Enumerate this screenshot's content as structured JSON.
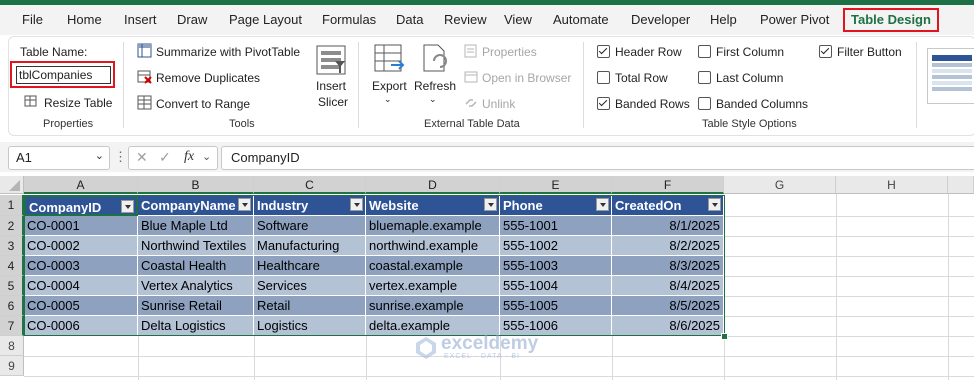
{
  "ribbon_tabs": [
    "File",
    "Home",
    "Insert",
    "Draw",
    "Page Layout",
    "Formulas",
    "Data",
    "Review",
    "View",
    "Automate",
    "Developer",
    "Help",
    "Power Pivot",
    "Table Design"
  ],
  "active_tab": "Table Design",
  "properties": {
    "table_name_label": "Table Name:",
    "table_name_value": "tblCompanies",
    "resize_table": "Resize Table",
    "group_label": "Properties"
  },
  "tools": {
    "summarize": "Summarize with PivotTable",
    "remove_duplicates": "Remove Duplicates",
    "convert_to_range": "Convert to Range",
    "insert_slicer_line1": "Insert",
    "insert_slicer_line2": "Slicer",
    "group_label": "Tools"
  },
  "external": {
    "export": "Export",
    "refresh": "Refresh",
    "properties": "Properties",
    "open_in_browser": "Open in Browser",
    "unlink": "Unlink",
    "group_label": "External Table Data"
  },
  "style_options": {
    "header_row": "Header Row",
    "total_row": "Total Row",
    "banded_rows": "Banded Rows",
    "first_column": "First Column",
    "last_column": "Last Column",
    "banded_columns": "Banded Columns",
    "filter_button": "Filter Button",
    "group_label": "Table Style Options",
    "checked": {
      "header_row": true,
      "total_row": false,
      "banded_rows": true,
      "first_column": false,
      "last_column": false,
      "banded_columns": false,
      "filter_button": true
    }
  },
  "formula_bar": {
    "name_box": "A1",
    "fx": "fx",
    "content": "CompanyID"
  },
  "columns": [
    "A",
    "B",
    "C",
    "D",
    "E",
    "F",
    "G",
    "H"
  ],
  "row_numbers": [
    "1",
    "2",
    "3",
    "4",
    "5",
    "6",
    "7",
    "8",
    "9"
  ],
  "table": {
    "headers": [
      "CompanyID",
      "CompanyName",
      "Industry",
      "Website",
      "Phone",
      "CreatedOn"
    ],
    "rows": [
      [
        "CO-0001",
        "Blue Maple Ltd",
        "Software",
        "bluemaple.example",
        "555-1001",
        "8/1/2025"
      ],
      [
        "CO-0002",
        "Northwind Textiles",
        "Manufacturing",
        "northwind.example",
        "555-1002",
        "8/2/2025"
      ],
      [
        "CO-0003",
        "Coastal Health",
        "Healthcare",
        "coastal.example",
        "555-1003",
        "8/3/2025"
      ],
      [
        "CO-0004",
        "Vertex Analytics",
        "Services",
        "vertex.example",
        "555-1004",
        "8/4/2025"
      ],
      [
        "CO-0005",
        "Sunrise Retail",
        "Retail",
        "sunrise.example",
        "555-1005",
        "8/5/2025"
      ],
      [
        "CO-0006",
        "Delta Logistics",
        "Logistics",
        "delta.example",
        "555-1006",
        "8/6/2025"
      ]
    ]
  },
  "watermark": {
    "name": "exceldemy",
    "tagline": "EXCEL · DATA · BI"
  },
  "colors": {
    "accent": "#1e7145",
    "highlight": "#e0161e",
    "table_header": "#2f5496",
    "band_dark": "#8ea2bf",
    "band_light": "#b4c2d6"
  }
}
